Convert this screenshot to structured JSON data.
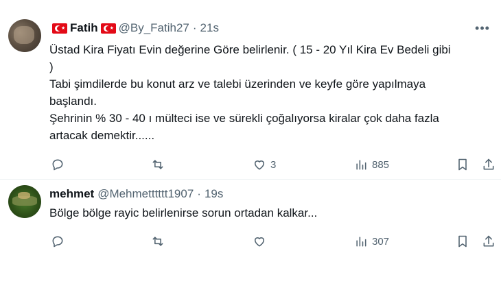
{
  "tweets": [
    {
      "name": "Fatih",
      "handle": "@By_Fatih27",
      "separator": "·",
      "time": "21s",
      "more_label": "•••",
      "lines": [
        "Üstad Kira Fiyatı Evin değerine Göre belirlenir. ( 15 - 20 Yıl Kira Ev Bedeli gibi",
        ")",
        "Tabi şimdilerde bu konut arz ve talebi üzerinden ve keyfe göre yapılmaya",
        "başlandı.",
        "Şehrinin % 30 - 40 ı mülteci ise ve sürekli çoğalıyorsa kiralar çok daha fazla",
        "artacak demektir......"
      ],
      "likes": "3",
      "views": "885"
    },
    {
      "name": "mehmet",
      "handle": "@Mehmetttttt1907",
      "separator": "·",
      "time": "19s",
      "lines": [
        "Bölge bölge rayic belirlenirse sorun ortadan kalkar..."
      ],
      "likes": "",
      "views": "307"
    }
  ],
  "icons": {
    "reply": "reply-icon",
    "retweet": "retweet-icon",
    "like": "heart-icon",
    "views": "views-icon",
    "bookmark": "bookmark-icon",
    "share": "share-icon",
    "flag": "turkish-flag-icon",
    "more": "more-icon"
  },
  "colors": {
    "text": "#0f1419",
    "secondary": "#536471",
    "divider": "#eff3f4",
    "flag": "#e30a17"
  }
}
